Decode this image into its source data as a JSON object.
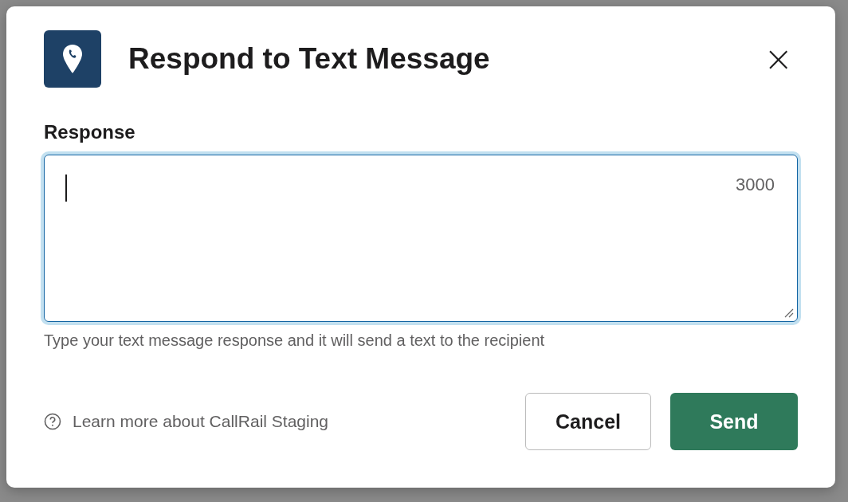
{
  "dialog": {
    "title": "Respond to Text Message",
    "close": "×"
  },
  "response": {
    "label": "Response",
    "focused": true,
    "counter": "3000",
    "hint": "Type your text message response and it will send a text to the recipient"
  },
  "footer": {
    "help_link": "Learn more about CallRail Staging",
    "buttons": [
      {
        "label": "Cancel",
        "kind": "secondary"
      },
      {
        "label": "Send",
        "kind": "primary"
      }
    ]
  }
}
